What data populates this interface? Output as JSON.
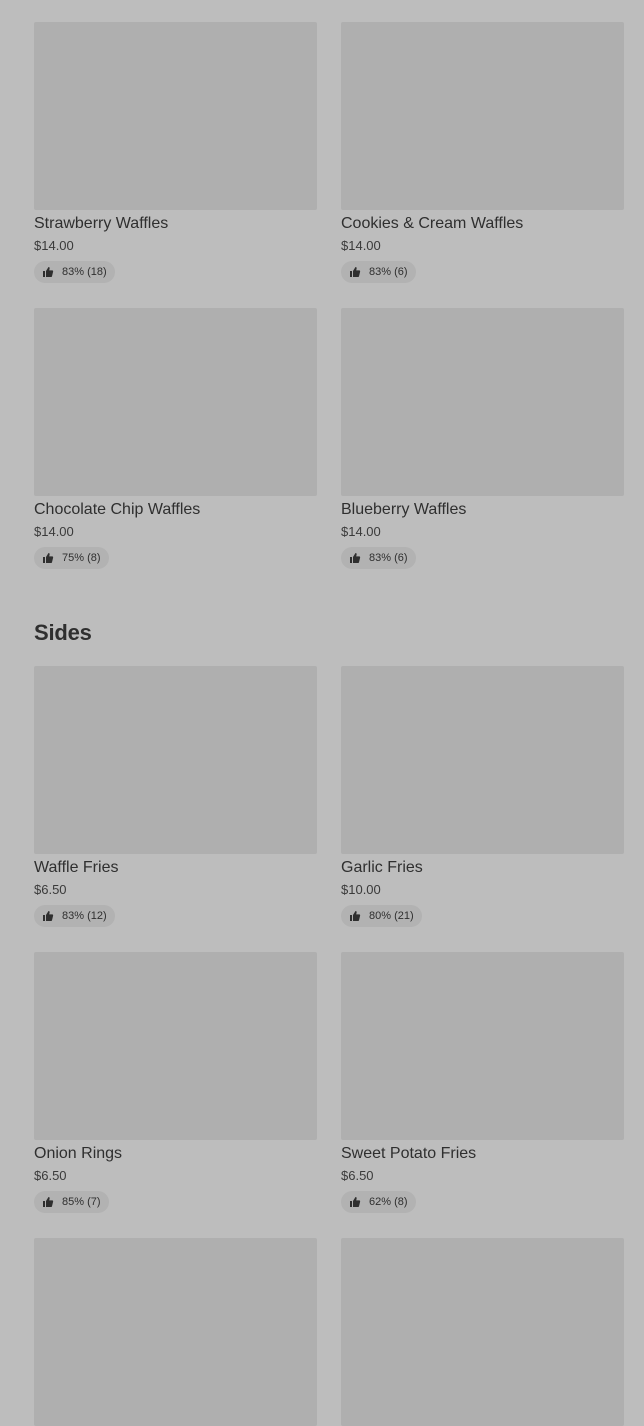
{
  "sections": [
    {
      "title": "",
      "items": [
        {
          "name": "Strawberry Waffles",
          "price": "$14.00",
          "rating": "83% (18)"
        },
        {
          "name": "Cookies & Cream Waffles",
          "price": "$14.00",
          "rating": "83% (6)"
        },
        {
          "name": "Chocolate Chip Waffles",
          "price": "$14.00",
          "rating": "75% (8)"
        },
        {
          "name": "Blueberry Waffles",
          "price": "$14.00",
          "rating": "83% (6)"
        }
      ]
    },
    {
      "title": "Sides",
      "items": [
        {
          "name": "Waffle Fries",
          "price": "$6.50",
          "rating": "83% (12)"
        },
        {
          "name": "Garlic Fries",
          "price": "$10.00",
          "rating": "80% (21)"
        },
        {
          "name": "Onion Rings",
          "price": "$6.50",
          "rating": "85% (7)"
        },
        {
          "name": "Sweet Potato Fries",
          "price": "$6.50",
          "rating": "62% (8)"
        }
      ]
    }
  ],
  "icons": {
    "rating_icon": "thumbs-up-icon"
  },
  "colors": {
    "background": "#bdbdbd",
    "image_placeholder": "#afafaf",
    "rating_pill": "#b2b2b2",
    "text": "#2f2f2f"
  }
}
